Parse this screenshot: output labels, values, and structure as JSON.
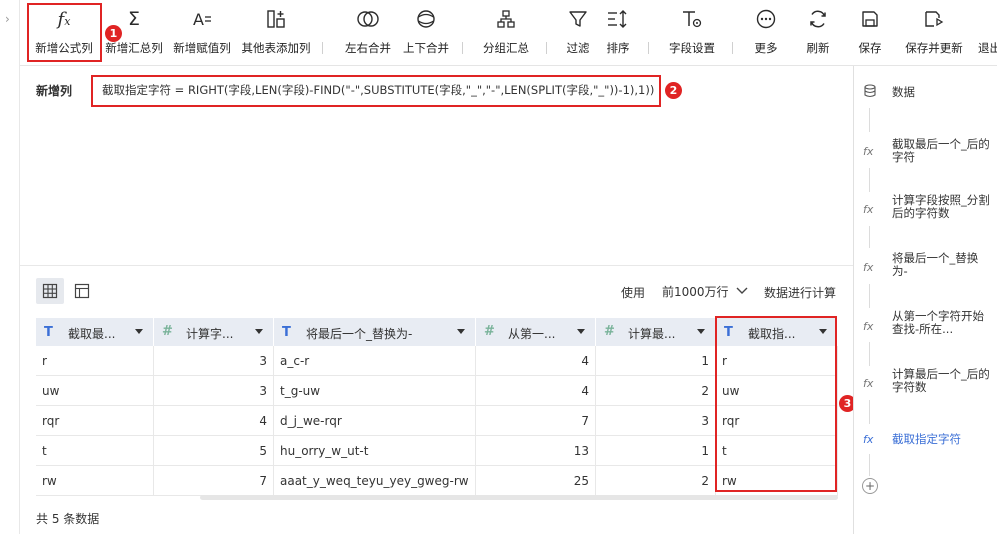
{
  "toolbar": {
    "buttons": [
      {
        "label": "新增公式列",
        "icon": "fx-icon"
      },
      {
        "label": "新增汇总列",
        "icon": "sigma-icon"
      },
      {
        "label": "新增赋值列",
        "icon": "assign-icon"
      },
      {
        "label": "其他表添加列",
        "icon": "add-column-icon"
      },
      {
        "label": "左右合并",
        "icon": "merge-horizontal-icon"
      },
      {
        "label": "上下合并",
        "icon": "merge-vertical-icon"
      },
      {
        "label": "分组汇总",
        "icon": "group-summary-icon"
      },
      {
        "label": "过滤",
        "icon": "filter-icon"
      },
      {
        "label": "排序",
        "icon": "sort-icon"
      },
      {
        "label": "字段设置",
        "icon": "field-settings-icon"
      },
      {
        "label": "更多",
        "icon": "more-icon"
      },
      {
        "label": "刷新",
        "icon": "refresh-icon"
      },
      {
        "label": "保存",
        "icon": "save-icon"
      },
      {
        "label": "保存并更新",
        "icon": "save-update-icon"
      },
      {
        "label": "退出",
        "icon": "exit-icon"
      }
    ]
  },
  "annotations": [
    "1",
    "2",
    "3"
  ],
  "formula": {
    "label": "新增列",
    "text": "截取指定字符 = RIGHT(字段,LEN(字段)-FIND(\"-\",SUBSTITUTE(字段,\"_\",\"-\",LEN(SPLIT(字段,\"_\"))-1),1))"
  },
  "table_controls": {
    "use_label": "使用",
    "rows_option": "前1000万行",
    "calc_label": "数据进行计算"
  },
  "table": {
    "columns": [
      {
        "name": "截取最...",
        "type": "text"
      },
      {
        "name": "计算字...",
        "type": "number"
      },
      {
        "name": "将最后一个_替换为-",
        "type": "text"
      },
      {
        "name": "从第一...",
        "type": "number"
      },
      {
        "name": "计算最...",
        "type": "number"
      },
      {
        "name": "截取指...",
        "type": "text"
      }
    ],
    "rows": [
      [
        "r",
        "3",
        "a_c-r",
        "4",
        "1",
        "r"
      ],
      [
        "uw",
        "3",
        "t_g-uw",
        "4",
        "2",
        "uw"
      ],
      [
        "rqr",
        "4",
        "d_j_we-rqr",
        "7",
        "3",
        "rqr"
      ],
      [
        "t",
        "5",
        "hu_orry_w_ut-t",
        "13",
        "1",
        "t"
      ],
      [
        "rw",
        "7",
        "aaat_y_weq_teyu_yey_gweg-rw",
        "25",
        "2",
        "rw"
      ]
    ],
    "total": "共 5 条数据"
  },
  "side_panel": {
    "items": [
      {
        "label": "数据",
        "icon": "database-icon"
      },
      {
        "label": "截取最后一个_后的字符",
        "icon": "fx-icon"
      },
      {
        "label": "计算字段按照_分割后的字符数",
        "icon": "fx-icon"
      },
      {
        "label": "将最后一个_替换为-",
        "icon": "fx-icon"
      },
      {
        "label": "从第一个字符开始查找-所在...",
        "icon": "fx-icon"
      },
      {
        "label": "计算最后一个_后的字符数",
        "icon": "fx-icon"
      },
      {
        "label": "截取指定字符",
        "icon": "fx-icon",
        "active": true
      }
    ],
    "add_symbol": "+"
  },
  "colors": {
    "accent": "#3b6fd6",
    "annotation_red": "#e02424",
    "header_bg": "#e8ecf3"
  }
}
